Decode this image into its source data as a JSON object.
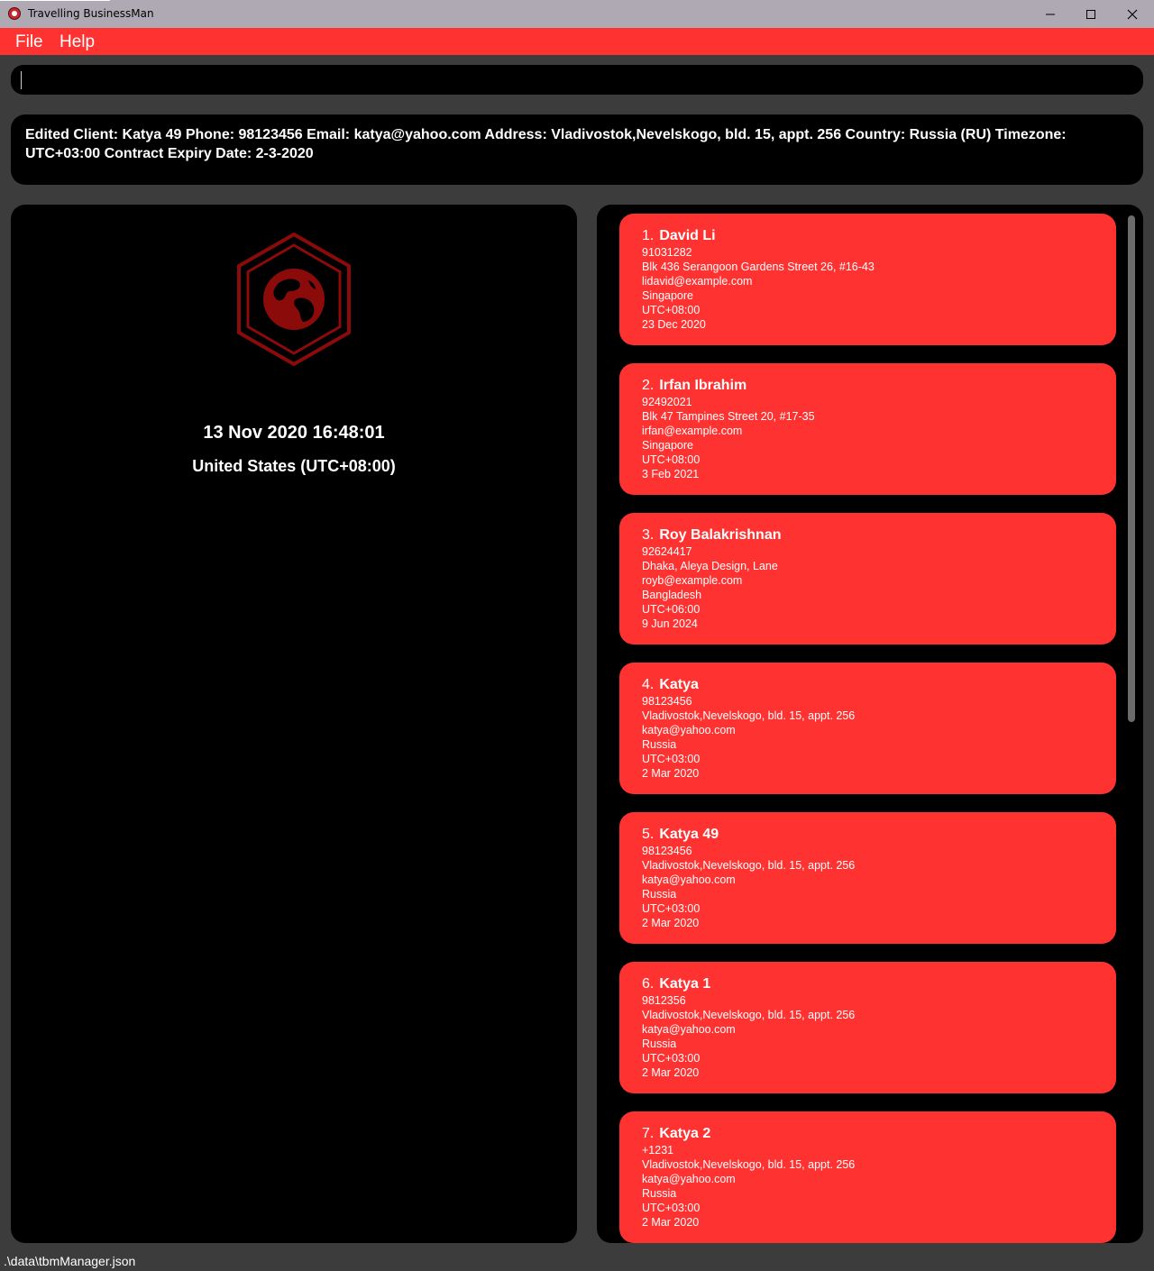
{
  "window": {
    "title": "Travelling BusinessMan",
    "minimize_label": "Minimize",
    "maximize_label": "Maximize",
    "close_label": "Close"
  },
  "menu": {
    "file": "File",
    "help": "Help"
  },
  "command_box": {
    "value": "",
    "placeholder": ""
  },
  "result": {
    "text": "Edited Client: Katya 49 Phone: 98123456 Email: katya@yahoo.com Address: Vladivostok,Nevelskogo, bld. 15, appt. 256 Country: Russia (RU) Timezone: UTC+03:00 Contract Expiry Date: 2-3-2020"
  },
  "clock": {
    "datetime": "13 Nov 2020 16:48:01",
    "location": "United States (UTC+08:00)",
    "logo_icon": "globe-hexagon-icon"
  },
  "clients": [
    {
      "index": "1.",
      "name": "David Li",
      "phone": "91031282",
      "address": "Blk 436 Serangoon Gardens Street 26, #16-43",
      "email": "lidavid@example.com",
      "country": "Singapore",
      "timezone": "UTC+08:00",
      "expiry": "23 Dec 2020"
    },
    {
      "index": "2.",
      "name": "Irfan Ibrahim",
      "phone": "92492021",
      "address": "Blk 47 Tampines Street 20, #17-35",
      "email": "irfan@example.com",
      "country": "Singapore",
      "timezone": "UTC+08:00",
      "expiry": "3 Feb 2021"
    },
    {
      "index": "3.",
      "name": "Roy Balakrishnan",
      "phone": "92624417",
      "address": "Dhaka, Aleya Design, Lane",
      "email": "royb@example.com",
      "country": "Bangladesh",
      "timezone": "UTC+06:00",
      "expiry": "9 Jun 2024"
    },
    {
      "index": "4.",
      "name": "Katya",
      "phone": "98123456",
      "address": "Vladivostok,Nevelskogo, bld. 15, appt. 256",
      "email": "katya@yahoo.com",
      "country": "Russia",
      "timezone": "UTC+03:00",
      "expiry": "2 Mar 2020"
    },
    {
      "index": "5.",
      "name": "Katya 49",
      "phone": "98123456",
      "address": "Vladivostok,Nevelskogo, bld. 15, appt. 256",
      "email": "katya@yahoo.com",
      "country": "Russia",
      "timezone": "UTC+03:00",
      "expiry": "2 Mar 2020"
    },
    {
      "index": "6.",
      "name": "Katya 1",
      "phone": "9812356",
      "address": "Vladivostok,Nevelskogo, bld. 15, appt. 256",
      "email": "katya@yahoo.com",
      "country": "Russia",
      "timezone": "UTC+03:00",
      "expiry": "2 Mar 2020"
    },
    {
      "index": "7.",
      "name": "Katya 2",
      "phone": "+1231",
      "address": "Vladivostok,Nevelskogo, bld. 15, appt. 256",
      "email": "katya@yahoo.com",
      "country": "Russia",
      "timezone": "UTC+03:00",
      "expiry": "2 Mar 2020"
    }
  ],
  "status": {
    "file_path": ".\\data\\tbmManager.json"
  },
  "colors": {
    "accent": "#ff3232",
    "panel": "#000000",
    "background": "#3c3c3c",
    "logo": "#8b0a0a"
  }
}
